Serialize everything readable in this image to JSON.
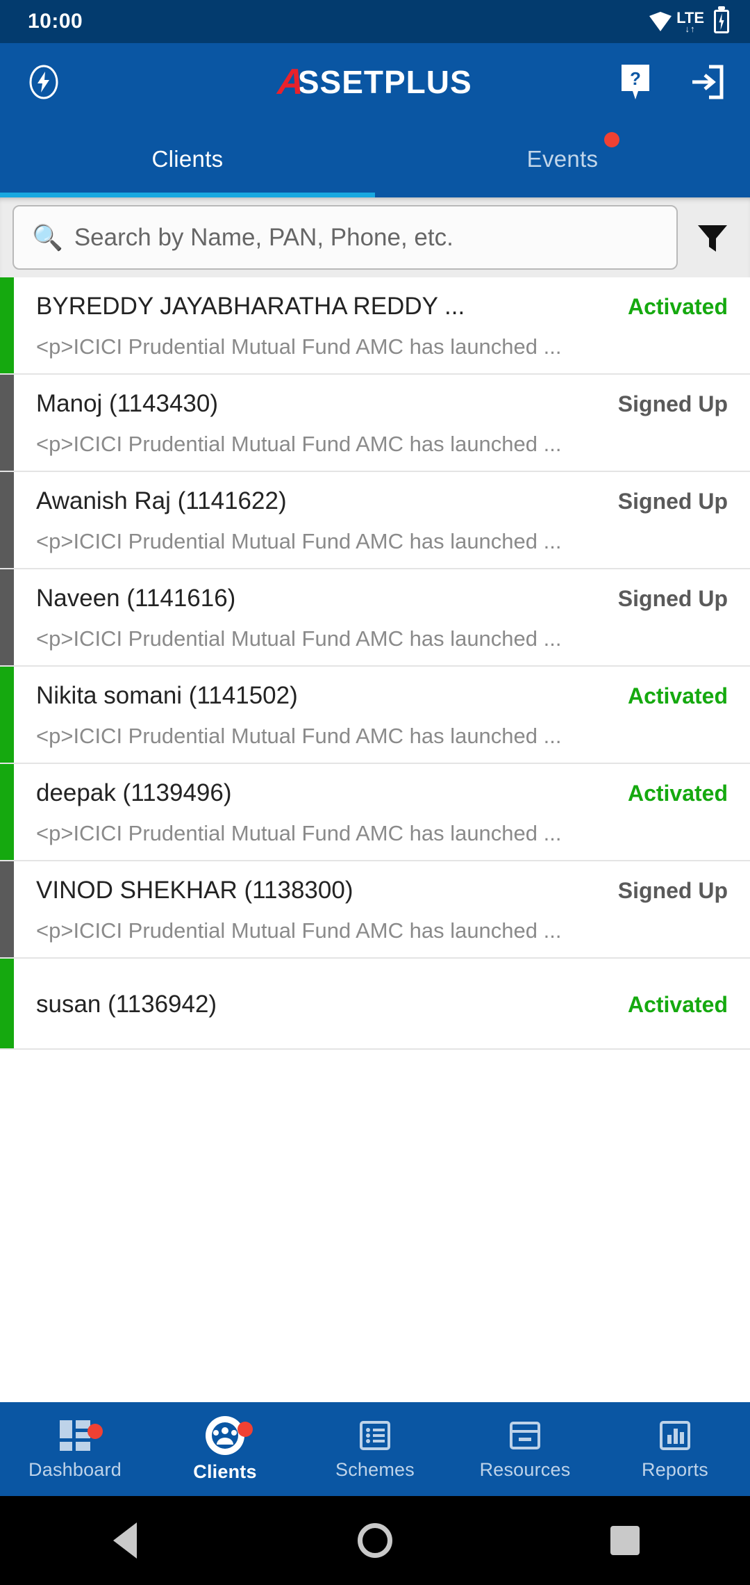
{
  "status_bar": {
    "time": "10:00",
    "network_label": "LTE",
    "network_arrows": "↓↑",
    "wifi_icon": "wifi-icon",
    "battery_icon": "battery-charging-icon"
  },
  "app_bar": {
    "brand_mark": "A",
    "brand_text": "SSETPLUS",
    "brand_full": "ASSETPLUS",
    "brand_mark_color": "#e8222c",
    "left_icon": "flash-circle-icon",
    "help_icon": "help-question-icon",
    "logout_icon": "logout-icon"
  },
  "tabs": {
    "items": [
      {
        "label": "Clients",
        "active": true,
        "badge": false
      },
      {
        "label": "Events",
        "active": false,
        "badge": true
      }
    ],
    "indicator_color": "#18a8e0",
    "badge_color": "#f04133"
  },
  "search": {
    "placeholder": "Search by Name, PAN, Phone, etc.",
    "value": "",
    "search_icon": "magnifier-icon",
    "filter_icon": "funnel-filter-icon"
  },
  "clients": {
    "status_colors": {
      "Activated": "#15a90f",
      "Signed Up": "#5a5a5a"
    },
    "rows": [
      {
        "name": "BYREDDY JAYABHARATHA REDDY  ...",
        "status": "Activated",
        "bar": "#15a90f",
        "note": "<p>ICICI Prudential Mutual Fund AMC has launched ..."
      },
      {
        "name": "Manoj  (1143430)",
        "status": "Signed Up",
        "bar": "#5a5a5a",
        "note": "<p>ICICI Prudential Mutual Fund AMC has launched ..."
      },
      {
        "name": "Awanish Raj  (1141622)",
        "status": "Signed Up",
        "bar": "#5a5a5a",
        "note": "<p>ICICI Prudential Mutual Fund AMC has launched ..."
      },
      {
        "name": "Naveen   (1141616)",
        "status": "Signed Up",
        "bar": "#5a5a5a",
        "note": "<p>ICICI Prudential Mutual Fund AMC has launched ..."
      },
      {
        "name": "Nikita somani  (1141502)",
        "status": "Activated",
        "bar": "#15a90f",
        "note": "<p>ICICI Prudential Mutual Fund AMC has launched ..."
      },
      {
        "name": "deepak  (1139496)",
        "status": "Activated",
        "bar": "#15a90f",
        "note": "<p>ICICI Prudential Mutual Fund AMC has launched ..."
      },
      {
        "name": "VINOD  SHEKHAR  (1138300)",
        "status": "Signed Up",
        "bar": "#5a5a5a",
        "note": "<p>ICICI Prudential Mutual Fund AMC has launched ..."
      },
      {
        "name": "susan  (1136942)",
        "status": "Activated",
        "bar": "#15a90f",
        "note": ""
      }
    ]
  },
  "bottom_nav": {
    "items": [
      {
        "label": "Dashboard",
        "icon": "dashboard-grid-icon",
        "active": false,
        "badge": true
      },
      {
        "label": "Clients",
        "icon": "clients-people-icon",
        "active": true,
        "badge": true
      },
      {
        "label": "Schemes",
        "icon": "schemes-list-icon",
        "active": false,
        "badge": false
      },
      {
        "label": "Resources",
        "icon": "resources-archive-icon",
        "active": false,
        "badge": false
      },
      {
        "label": "Reports",
        "icon": "reports-chart-icon",
        "active": false,
        "badge": false
      }
    ]
  },
  "system_nav": {
    "back": "back-triangle-icon",
    "home": "home-circle-icon",
    "recents": "recents-square-icon"
  }
}
